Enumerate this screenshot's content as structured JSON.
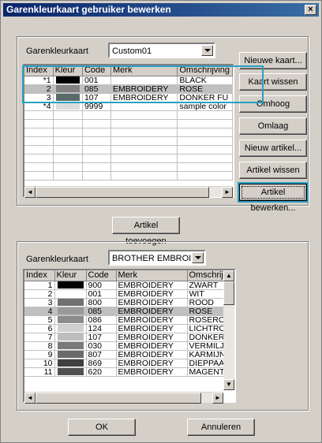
{
  "window": {
    "title": "Garenkleurkaart gebruiker bewerken",
    "close_glyph": "×"
  },
  "top": {
    "label": "Garenkleurkaart",
    "combo_value": "Custom01",
    "columns": [
      "Index",
      "Kleur",
      "Code",
      "Merk",
      "Omschrijving"
    ],
    "rows": [
      {
        "index": "*1",
        "color": "#000000",
        "code": "001",
        "brand": "",
        "desc": "BLACK",
        "selected": false
      },
      {
        "index": "2",
        "color": "#808080",
        "code": "085",
        "brand": "EMBROIDERY",
        "desc": "ROSE",
        "selected": true
      },
      {
        "index": "3",
        "color": "#5a6a6a",
        "code": "107",
        "brand": "EMBROIDERY",
        "desc": "DONKER FU",
        "selected": false
      },
      {
        "index": "*4",
        "color": "#dcdcdc",
        "code": "9999",
        "brand": "",
        "desc": "sample color",
        "selected": false
      }
    ],
    "empty_rows": 8
  },
  "side_buttons": {
    "new_card": "Nieuwe kaart...",
    "delete_card": "Kaart wissen",
    "up": "Omhoog",
    "down": "Omlaag",
    "new_item": "Nieuw artikel...",
    "delete_item": "Artikel wissen",
    "edit_item": "Artikel bewerken..."
  },
  "add_button": "Artikel toevoegen",
  "bottom": {
    "label": "Garenkleurkaart",
    "combo_value": "BROTHER EMBROIDI",
    "columns": [
      "Index",
      "Kleur",
      "Code",
      "Merk",
      "Omschrijvi"
    ],
    "rows": [
      {
        "index": "1",
        "color": "#000000",
        "code": "900",
        "brand": "EMBROIDERY",
        "desc": "ZWART",
        "selected": false
      },
      {
        "index": "2",
        "color": "#ffffff",
        "code": "001",
        "brand": "EMBROIDERY",
        "desc": "WIT",
        "selected": false
      },
      {
        "index": "3",
        "color": "#707070",
        "code": "800",
        "brand": "EMBROIDERY",
        "desc": "ROOD",
        "selected": false
      },
      {
        "index": "4",
        "color": "#9a9a9a",
        "code": "085",
        "brand": "EMBROIDERY",
        "desc": "ROSE",
        "selected": true
      },
      {
        "index": "5",
        "color": "#8c8c8c",
        "code": "086",
        "brand": "EMBROIDERY",
        "desc": "ROSERO(",
        "selected": false
      },
      {
        "index": "6",
        "color": "#d0d0d0",
        "code": "124",
        "brand": "EMBROIDERY",
        "desc": "LICHTRO!",
        "selected": false
      },
      {
        "index": "7",
        "color": "#bdbdbd",
        "code": "107",
        "brand": "EMBROIDERY",
        "desc": "DONKER",
        "selected": false
      },
      {
        "index": "8",
        "color": "#7a7a7a",
        "code": "030",
        "brand": "EMBROIDERY",
        "desc": "VERMILJC",
        "selected": false
      },
      {
        "index": "9",
        "color": "#6a6a6a",
        "code": "807",
        "brand": "EMBROIDERY",
        "desc": "KARMIJN",
        "selected": false
      },
      {
        "index": "10",
        "color": "#404040",
        "code": "869",
        "brand": "EMBROIDERY",
        "desc": "DIEPPAAF",
        "selected": false
      },
      {
        "index": "11",
        "color": "#505050",
        "code": "620",
        "brand": "EMBROIDERY",
        "desc": "MAGENTA",
        "selected": false
      }
    ]
  },
  "footer": {
    "ok": "OK",
    "cancel": "Annuleren"
  },
  "scroll_glyphs": {
    "left": "◄",
    "right": "►",
    "up": "▲",
    "down": "▼"
  },
  "colors": {
    "highlight": "#2aa0c4",
    "title_start": "#0a246a",
    "title_end": "#3a6ea5",
    "face": "#d4d0c8"
  }
}
